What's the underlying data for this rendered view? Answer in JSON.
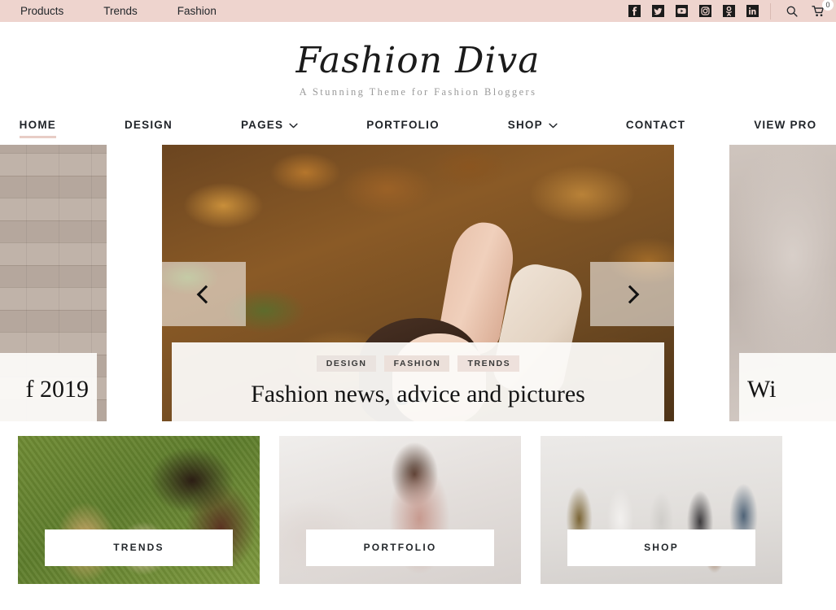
{
  "topbar": {
    "background": "#eed4ce",
    "menu": [
      {
        "label": "Products"
      },
      {
        "label": "Trends"
      },
      {
        "label": "Fashion"
      }
    ],
    "social": [
      {
        "name": "facebook-icon"
      },
      {
        "name": "twitter-icon"
      },
      {
        "name": "youtube-icon"
      },
      {
        "name": "instagram-icon"
      },
      {
        "name": "odnoklassniki-icon"
      },
      {
        "name": "linkedin-icon"
      }
    ],
    "search_icon": "search-icon",
    "cart_icon": "cart-icon",
    "cart_count": "0"
  },
  "branding": {
    "title": "Fashion Diva",
    "tagline": "A Stunning Theme for Fashion Bloggers"
  },
  "mainnav": {
    "items": [
      {
        "label": "HOME",
        "active": true,
        "caret": false
      },
      {
        "label": "DESIGN",
        "active": false,
        "caret": false
      },
      {
        "label": "PAGES",
        "active": false,
        "caret": true
      },
      {
        "label": "PORTFOLIO",
        "active": false,
        "caret": false
      },
      {
        "label": "SHOP",
        "active": false,
        "caret": true
      },
      {
        "label": "CONTACT",
        "active": false,
        "caret": false
      },
      {
        "label": "VIEW PRO",
        "active": false,
        "caret": false
      }
    ],
    "active_underline_color": "#e8cdc6"
  },
  "slider": {
    "prev_icon": "chevron-left-icon",
    "next_icon": "chevron-right-icon",
    "slides": {
      "previous": {
        "headline": "f 2019",
        "image": "wooden-planks-photo"
      },
      "current": {
        "tags": [
          "DESIGN",
          "FASHION",
          "TRENDS"
        ],
        "headline": "Fashion news, advice and pictures",
        "image": "woman-lying-in-autumn-leaves-photo"
      },
      "next": {
        "headline": "Wi",
        "image": "soft-neutral-photo"
      }
    }
  },
  "cards": [
    {
      "label": "TRENDS",
      "image": "two-women-on-grass-photo"
    },
    {
      "label": "PORTFOLIO",
      "image": "woman-in-studio-photo"
    },
    {
      "label": "SHOP",
      "image": "group-of-shoppers-photo"
    }
  ]
}
